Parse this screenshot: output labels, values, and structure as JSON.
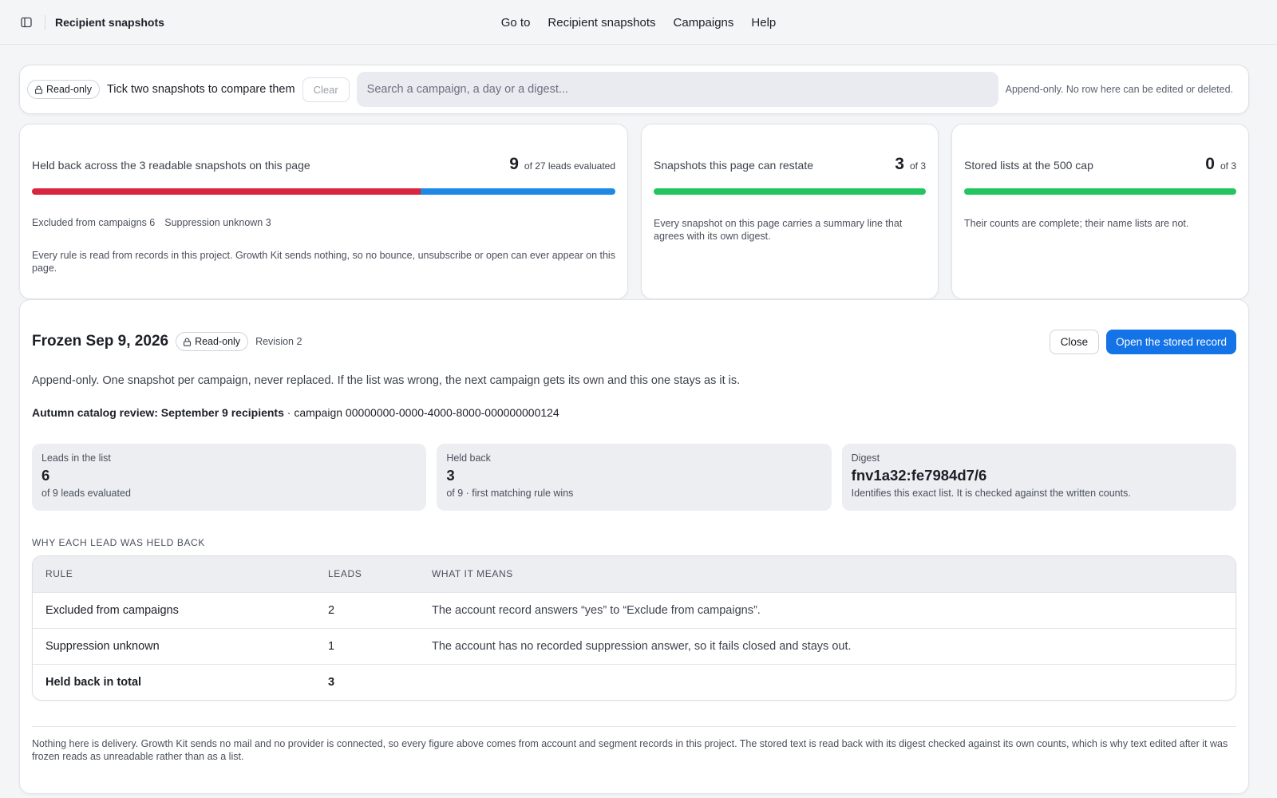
{
  "app": {
    "title": "Recipient snapshots"
  },
  "nav": {
    "items": [
      "Go to",
      "Recipient snapshots",
      "Campaigns",
      "Help"
    ]
  },
  "toolbar": {
    "badge": "Read-only",
    "hint": "Tick two snapshots to compare them",
    "clear_label": "Clear",
    "search_placeholder": "Search a campaign, a day or a digest...",
    "note": "Append-only. No row here can be edited or deleted."
  },
  "summary": {
    "held": {
      "label": "Held back across the 3 readable snapshots on this page",
      "value": "9",
      "of_text": "of 27 leads evaluated",
      "segments": [
        {
          "name": "Excluded from campaigns",
          "count": 6,
          "color": "#d7263d"
        },
        {
          "name": "Suppression unknown",
          "count": 3,
          "color": "#1e88e5"
        }
      ],
      "legend": [
        "Excluded from campaigns 6",
        "Suppression unknown 3"
      ],
      "description": "Every rule is read from records in this project. Growth Kit sends nothing, so no bounce, unsubscribe or open can ever appear on this page."
    },
    "restate": {
      "label": "Snapshots this page can restate",
      "value": "3",
      "of_text": "of 3",
      "fill": 1.0,
      "color": "#22c55e",
      "description": "Every snapshot on this page carries a summary line that agrees with its own digest."
    },
    "cap": {
      "label": "Stored lists at the 500 cap",
      "value": "0",
      "of_text": "of 3",
      "fill": 1.0,
      "color": "#22c55e",
      "description": "Their counts are complete; their name lists are not."
    }
  },
  "detail": {
    "title": "Frozen Sep 9, 2026",
    "badge": "Read-only",
    "revision": "Revision 2",
    "close_label": "Close",
    "open_label": "Open the stored record",
    "description": "Append-only. One snapshot per campaign, never replaced. If the list was wrong, the next campaign gets its own and this one stays as it is.",
    "campaign_name": "Autumn catalog review: September 9 recipients",
    "campaign_id": " · campaign 00000000-0000-4000-8000-000000000124",
    "tiles": [
      {
        "label": "Leads in the list",
        "value": "6",
        "sub": "of 9 leads evaluated"
      },
      {
        "label": "Held back",
        "value": "3",
        "sub": "of 9 · first matching rule wins"
      },
      {
        "label": "Digest",
        "value": "fnv1a32:fe7984d7/6",
        "sub": "Identifies this exact list. It is checked against the written counts."
      }
    ],
    "section_heading": "Why each lead was held back",
    "table": {
      "headers": [
        "Rule",
        "Leads",
        "What it means"
      ],
      "rows": [
        [
          "Excluded from campaigns",
          "2",
          "The account record answers “yes” to “Exclude from campaigns”."
        ],
        [
          "Suppression unknown",
          "1",
          "The account has no recorded suppression answer, so it fails closed and stays out."
        ],
        [
          "Held back in total",
          "3",
          ""
        ]
      ]
    },
    "footer": "Nothing here is delivery. Growth Kit sends no mail and no provider is connected, so every figure above comes from account and segment records in this project. The stored text is read back with its digest checked against its own counts, which is why text edited after it was frozen reads as unreadable rather than as a list."
  },
  "colors": {
    "accent": "#1473e6",
    "excluded": "#d7263d",
    "unknown": "#1e88e5",
    "ok": "#22c55e"
  },
  "icons": [
    "sidebar-toggle-icon",
    "lock-icon"
  ]
}
